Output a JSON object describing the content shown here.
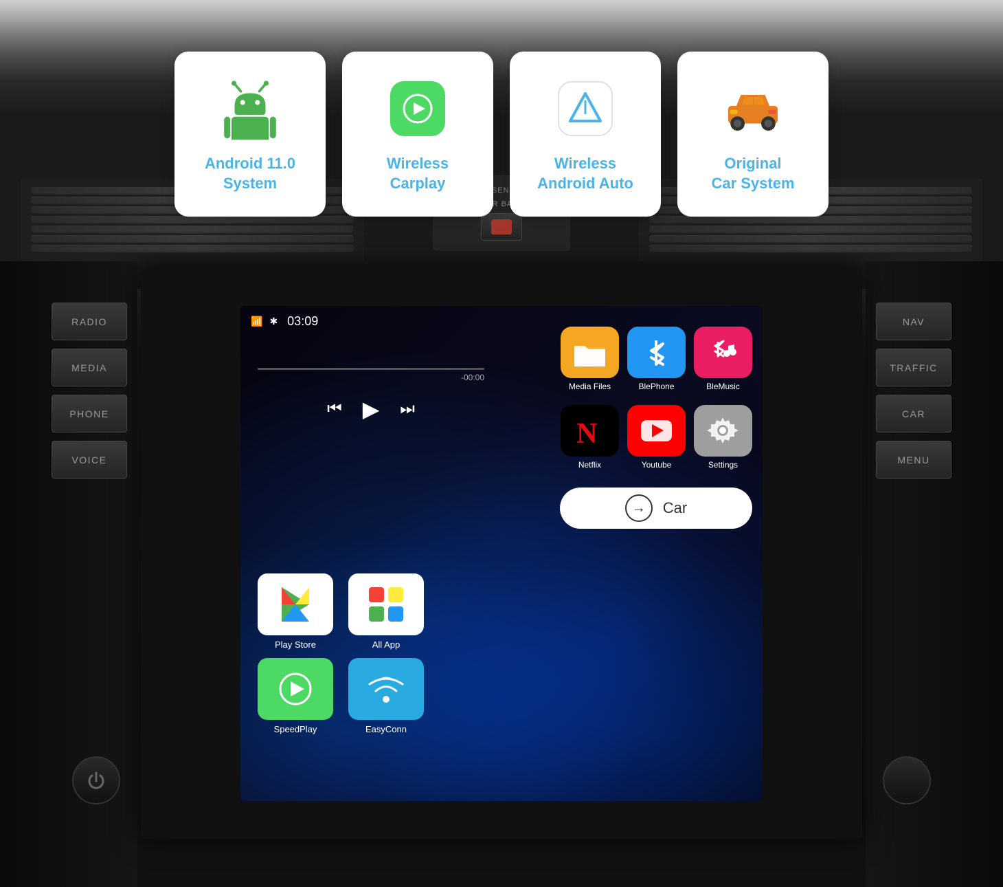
{
  "background": {
    "color_top": "#d0cfcf",
    "color_bottom": "#111"
  },
  "feature_cards": [
    {
      "id": "android-system",
      "label": "Android 11.0\nSystem",
      "label_line1": "Android 11.0",
      "label_line2": "System",
      "icon_type": "android",
      "icon_color": "#4caf50"
    },
    {
      "id": "wireless-carplay",
      "label": "Wireless\nCarplay",
      "label_line1": "Wireless",
      "label_line2": "Carplay",
      "icon_type": "carplay",
      "icon_bg": "#4cd964"
    },
    {
      "id": "wireless-android-auto",
      "label": "Wireless\nAndroid Auto",
      "label_line1": "Wireless",
      "label_line2": "Android Auto",
      "icon_type": "android-auto",
      "icon_color": "#4ab3e8"
    },
    {
      "id": "original-car-system",
      "label": "Original\nCar System",
      "label_line1": "Original",
      "label_line2": "Car System",
      "icon_type": "car",
      "icon_color": "#e67e22"
    }
  ],
  "left_buttons": [
    {
      "label": "RADIO"
    },
    {
      "label": "MEDIA"
    },
    {
      "label": "PHONE"
    },
    {
      "label": "VOICE"
    }
  ],
  "right_buttons": [
    {
      "label": "NAV"
    },
    {
      "label": "TRAFFIC"
    },
    {
      "label": "CAR"
    },
    {
      "label": "MENU"
    }
  ],
  "status_bar": {
    "time": "03:09",
    "wifi_icon": "▼",
    "bt_icon": "⁕"
  },
  "music_player": {
    "time_remaining": "-00:00",
    "prev_icon": "⏮",
    "play_icon": "▶",
    "next_icon": "⏭"
  },
  "app_grid": [
    {
      "label": "Play Store",
      "bg": "#ffffff",
      "icon_type": "playstore"
    },
    {
      "label": "All App",
      "bg": "#ffffff",
      "icon_type": "allapp"
    },
    {
      "label": "SpeedPlay",
      "bg": "#4cd964",
      "icon_type": "speedplay"
    },
    {
      "label": "EasyConn",
      "bg": "#29abe2",
      "icon_type": "easyconn"
    }
  ],
  "right_apps_row1": [
    {
      "label": "Media Files",
      "bg": "#f5a623",
      "icon_type": "folder",
      "text_color": "white"
    },
    {
      "label": "BlePhone",
      "bg": "#2196f3",
      "icon_type": "bluetooth",
      "text_color": "white"
    },
    {
      "label": "BleMusic",
      "bg": "#e91e63",
      "icon_type": "blemusic",
      "text_color": "white"
    }
  ],
  "right_apps_row2": [
    {
      "label": "Netflix",
      "bg": "#000000",
      "icon_type": "netflix",
      "text_color": "white"
    },
    {
      "label": "Youtube",
      "bg": "#ff0000",
      "icon_type": "youtube",
      "text_color": "white"
    },
    {
      "label": "Settings",
      "bg": "#9e9e9e",
      "icon_type": "settings",
      "text_color": "white"
    }
  ],
  "car_button": {
    "label": "Car"
  },
  "airbag": {
    "line1": "PASSENGER",
    "line2": "AIR BAG"
  }
}
